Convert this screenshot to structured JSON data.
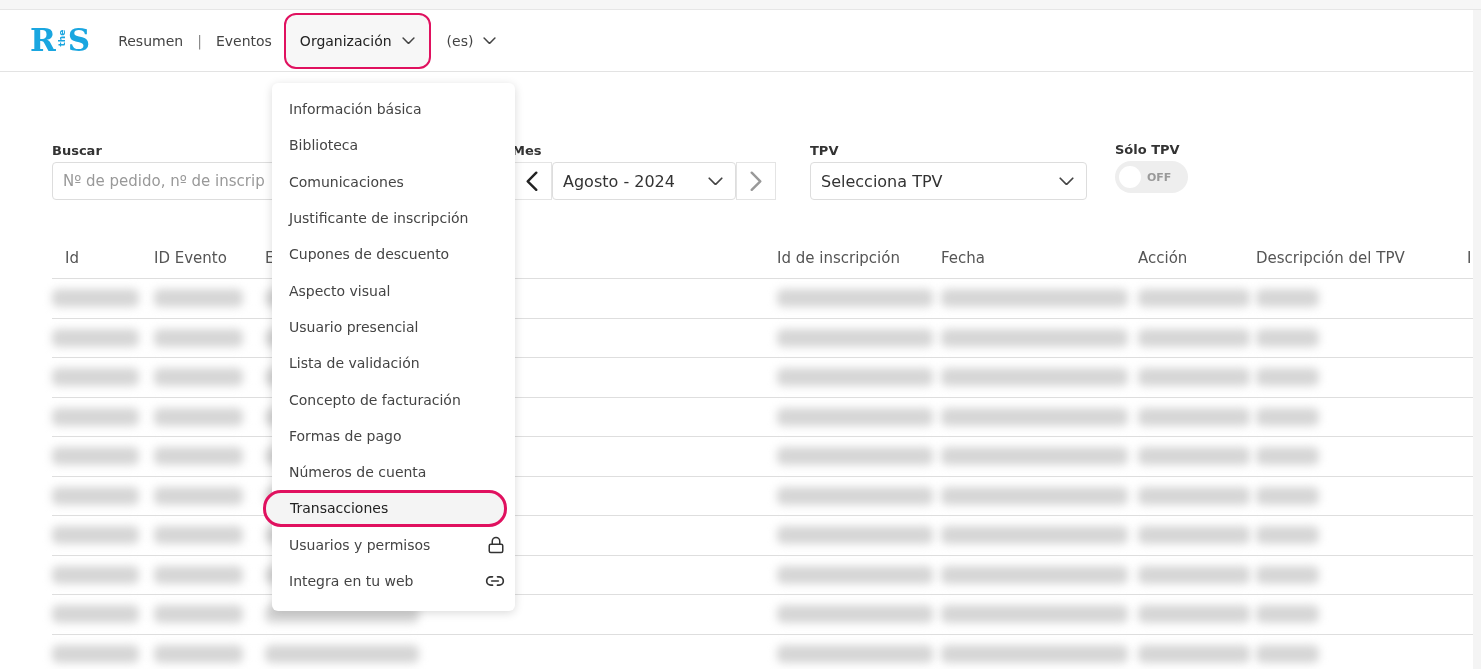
{
  "logo": {
    "left": "R",
    "middle": "the",
    "right": "S"
  },
  "nav": [
    {
      "label": "Resumen",
      "kind": "link"
    },
    {
      "label": "|",
      "kind": "separator"
    },
    {
      "label": "Eventos",
      "kind": "link"
    },
    {
      "label": "Organización",
      "kind": "dropdown",
      "selected": true
    },
    {
      "label": "(es)",
      "kind": "dropdown",
      "selected": false
    }
  ],
  "menu": {
    "items": [
      {
        "label": "Información básica",
        "selected": false
      },
      {
        "label": "Biblioteca",
        "selected": false
      },
      {
        "label": "Comunicaciones",
        "selected": false
      },
      {
        "label": "Justificante de inscripción",
        "selected": false
      },
      {
        "label": "Cupones de descuento",
        "selected": false
      },
      {
        "label": "Aspecto visual",
        "selected": false
      },
      {
        "label": "Usuario presencial",
        "selected": false
      },
      {
        "label": "Lista de validación",
        "selected": false
      },
      {
        "label": "Concepto de facturación",
        "selected": false
      },
      {
        "label": "Formas de pago",
        "selected": false
      },
      {
        "label": "Números de cuenta",
        "selected": false
      },
      {
        "label": "Transacciones",
        "selected": true
      },
      {
        "label": "Usuarios y permisos",
        "selected": false,
        "kind": "restricted"
      },
      {
        "label": "Integra en tu web",
        "selected": false,
        "kind": "embed"
      }
    ]
  },
  "filters": {
    "search": {
      "label": "Buscar",
      "placeholder": "Nº de pedido, nº de inscrip"
    },
    "month": {
      "label": "Mes",
      "value": "Agosto - 2024"
    },
    "tpv": {
      "label": "TPV",
      "value": "Selecciona TPV"
    },
    "only_tpv": {
      "label": "Sólo TPV",
      "on": false,
      "state_text": "OFF"
    }
  },
  "table": {
    "columns": [
      "Id",
      "ID Evento",
      "E",
      "Id de inscripción",
      "Fecha",
      "Acción",
      "Descripción del TPV",
      "I"
    ],
    "rows": [
      {
        "kind": "redacted"
      },
      {
        "kind": "redacted"
      },
      {
        "kind": "redacted"
      },
      {
        "kind": "redacted"
      },
      {
        "kind": "redacted"
      },
      {
        "kind": "redacted"
      },
      {
        "kind": "redacted"
      },
      {
        "kind": "redacted"
      },
      {
        "kind": "redacted"
      },
      {
        "kind": "redacted"
      }
    ]
  }
}
